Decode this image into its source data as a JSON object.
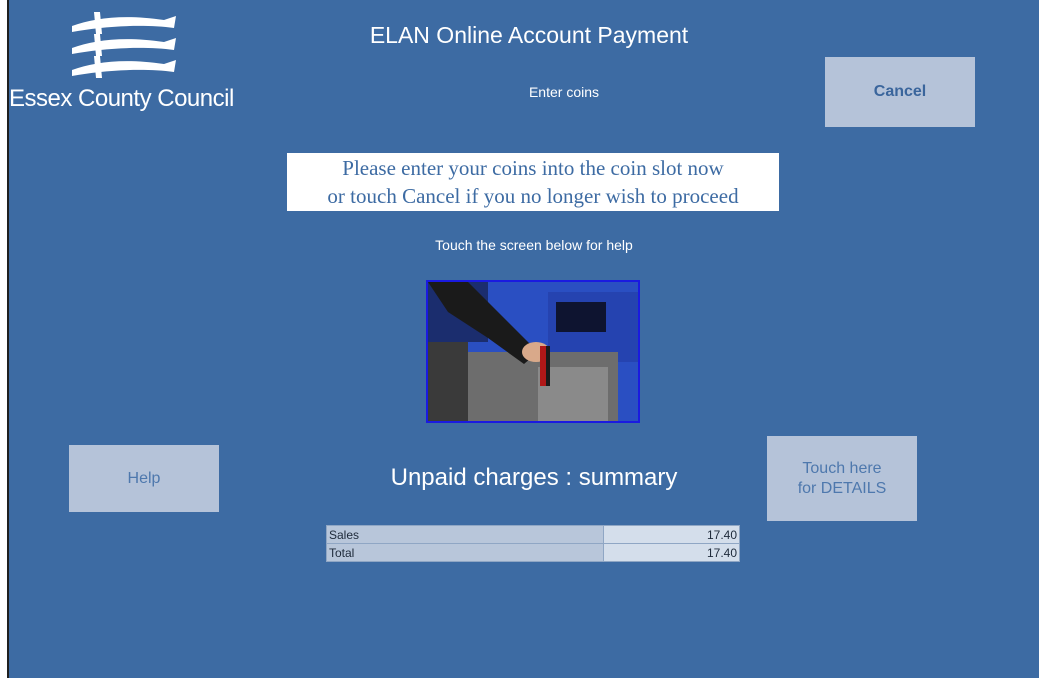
{
  "header": {
    "app_title": "ELAN Online Account Payment",
    "subtitle": "Enter coins",
    "council_name": "Essex County Council",
    "logo_icon": "three-seaxes-logo-icon"
  },
  "buttons": {
    "cancel_label": "Cancel",
    "help_label": "Help",
    "details_line1": "Touch here",
    "details_line2": "for DETAILS"
  },
  "instruction": {
    "line1": "Please enter your coins into the coin slot now",
    "line2": "or touch Cancel if you no longer wish to proceed"
  },
  "help_note": "Touch the screen below for help",
  "summary": {
    "title": "Unpaid charges : summary",
    "rows": [
      {
        "label": "Sales",
        "value": "17.40"
      },
      {
        "label": "Total",
        "value": "17.40"
      }
    ]
  },
  "colors": {
    "background": "#3d6ba3",
    "button": "#b5c3d9"
  }
}
